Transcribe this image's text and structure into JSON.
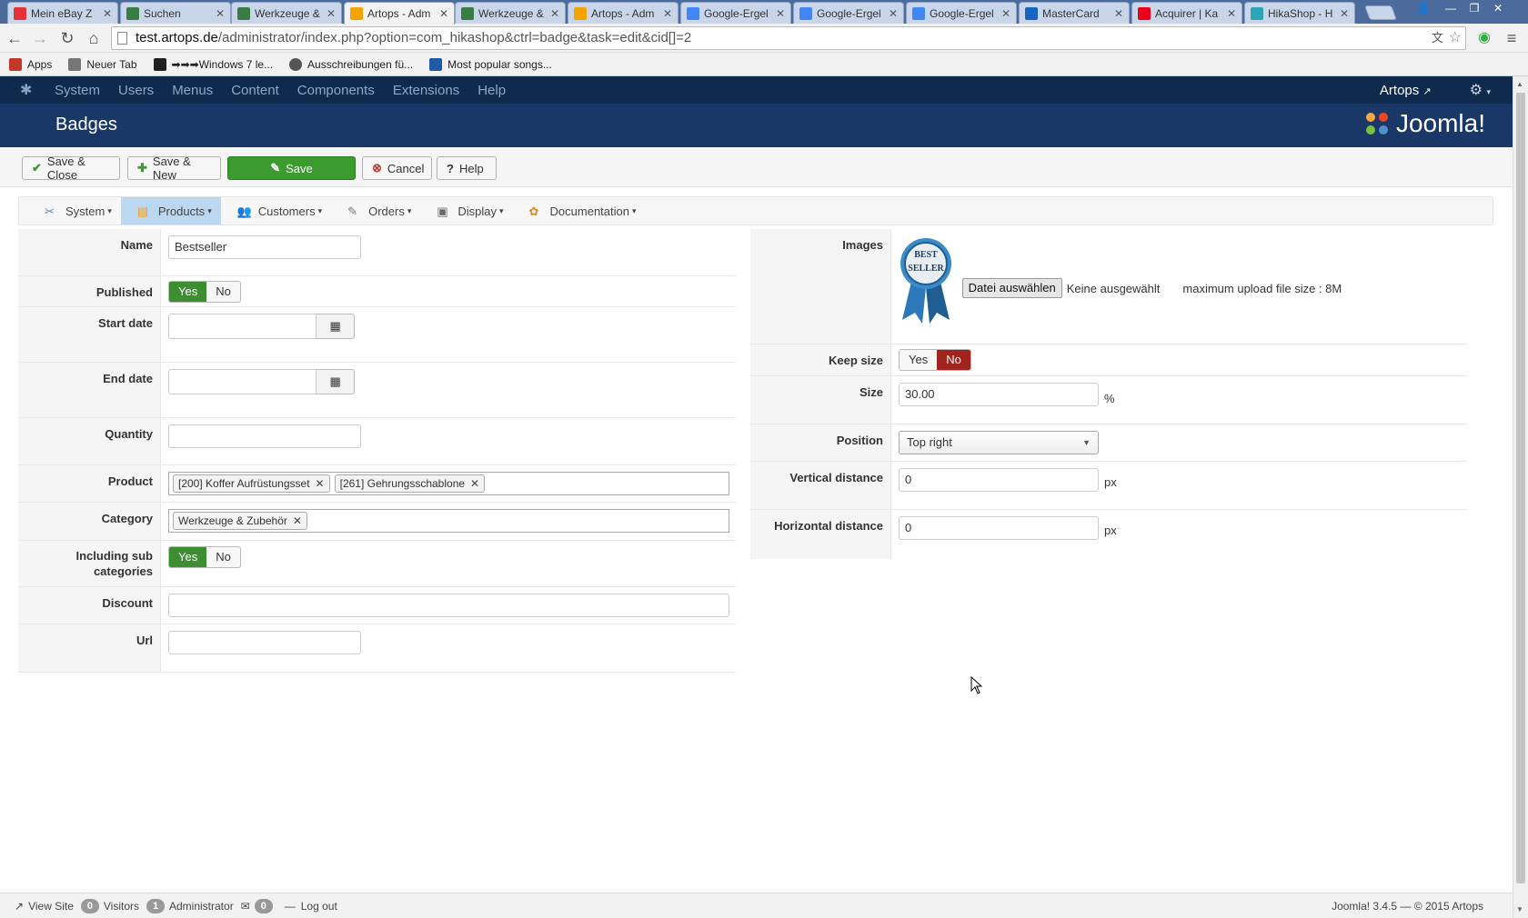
{
  "browser": {
    "tabs": [
      {
        "label": "Mein eBay Z",
        "icon": "ebay-icon",
        "color": "#e53238"
      },
      {
        "label": "Suchen",
        "icon": "site-a-icon",
        "color": "#3a7d44"
      },
      {
        "label": "Werkzeuge &",
        "icon": "site-a-icon",
        "color": "#3a7d44"
      },
      {
        "label": "Artops - Adm",
        "icon": "joomla-icon",
        "color": "#f4a300",
        "active": true
      },
      {
        "label": "Werkzeuge &",
        "icon": "site-a-icon",
        "color": "#3a7d44"
      },
      {
        "label": "Artops - Adm",
        "icon": "joomla-icon",
        "color": "#f4a300"
      },
      {
        "label": "Google-Ergel",
        "icon": "google-icon",
        "color": "#4285f4"
      },
      {
        "label": "Google-Ergel",
        "icon": "google-icon",
        "color": "#4285f4"
      },
      {
        "label": "Google-Ergel",
        "icon": "google-icon",
        "color": "#4285f4"
      },
      {
        "label": "MasterCard",
        "icon": "s-icon",
        "color": "#1565c0"
      },
      {
        "label": "Acquirer | Ka",
        "icon": "mastercard-icon",
        "color": "#eb001b"
      },
      {
        "label": "HikaShop - H",
        "icon": "hikashop-icon",
        "color": "#2aa6b4"
      }
    ],
    "url_host": "test.artops.de",
    "url_path": "/administrator/index.php?option=com_hikashop&ctrl=badge&task=edit&cid[]=2",
    "bookmarks": [
      {
        "label": "Apps",
        "icon": "apps-grid-icon"
      },
      {
        "label": "Neuer Tab",
        "icon": "page-icon"
      },
      {
        "label": "➡➡➡Windows 7 le...",
        "icon": "windows-icon"
      },
      {
        "label": "Ausschreibungen fü...",
        "icon": "globe-icon"
      },
      {
        "label": "Most popular songs...",
        "icon": "mp3-icon"
      }
    ]
  },
  "admin": {
    "menu": [
      "System",
      "Users",
      "Menus",
      "Content",
      "Components",
      "Extensions",
      "Help"
    ],
    "user": "Artops",
    "page_title": "Badges",
    "brand": "Joomla!"
  },
  "toolbar": {
    "save_close": "Save & Close",
    "save_new": "Save & New",
    "save": "Save",
    "cancel": "Cancel",
    "help": "Help"
  },
  "submenu": [
    {
      "label": "System",
      "icon": "tools-icon"
    },
    {
      "label": "Products",
      "icon": "products-icon",
      "active": true
    },
    {
      "label": "Customers",
      "icon": "customers-icon"
    },
    {
      "label": "Orders",
      "icon": "orders-icon"
    },
    {
      "label": "Display",
      "icon": "display-icon"
    },
    {
      "label": "Documentation",
      "icon": "documentation-icon"
    }
  ],
  "form_left": {
    "name_label": "Name",
    "name_value": "Bestseller",
    "published_label": "Published",
    "yes": "Yes",
    "no": "No",
    "start_date_label": "Start date",
    "end_date_label": "End date",
    "quantity_label": "Quantity",
    "product_label": "Product",
    "products": [
      "[200] Koffer Aufrüstungsset",
      "[261] Gehrungsschablone"
    ],
    "category_label": "Category",
    "categories": [
      "Werkzeuge & Zubehör"
    ],
    "subcat_label_1": "Including sub",
    "subcat_label_2": "categories",
    "discount_label": "Discount",
    "url_label": "Url"
  },
  "form_right": {
    "images_label": "Images",
    "badge_line1": "BEST",
    "badge_line2": "SELLER",
    "file_button": "Datei auswählen",
    "file_none": "Keine ausgewählt",
    "max_upload": "maximum upload file size : 8M",
    "keep_size_label": "Keep size",
    "yes": "Yes",
    "no": "No",
    "size_label": "Size",
    "size_value": "30.00",
    "size_unit": "%",
    "position_label": "Position",
    "position_value": "Top right",
    "vdist_label": "Vertical distance",
    "vdist_value": "0",
    "hdist_label": "Horizontal distance",
    "hdist_value": "0",
    "px": "px"
  },
  "footer": {
    "view_site": "View Site",
    "visitors_count": "0",
    "visitors": "Visitors",
    "admin_count": "1",
    "admin": "Administrator",
    "msg_count": "0",
    "logout": "Log out",
    "copyright": "Joomla! 3.4.5 — © 2015 Artops"
  },
  "colors": {
    "nav": "#0f2a4d",
    "header": "#1a3867",
    "save_green": "#3b9b2e",
    "toggle_green": "#3c8e31",
    "toggle_red": "#a0241d",
    "submenu_active": "#bcd7f0"
  }
}
